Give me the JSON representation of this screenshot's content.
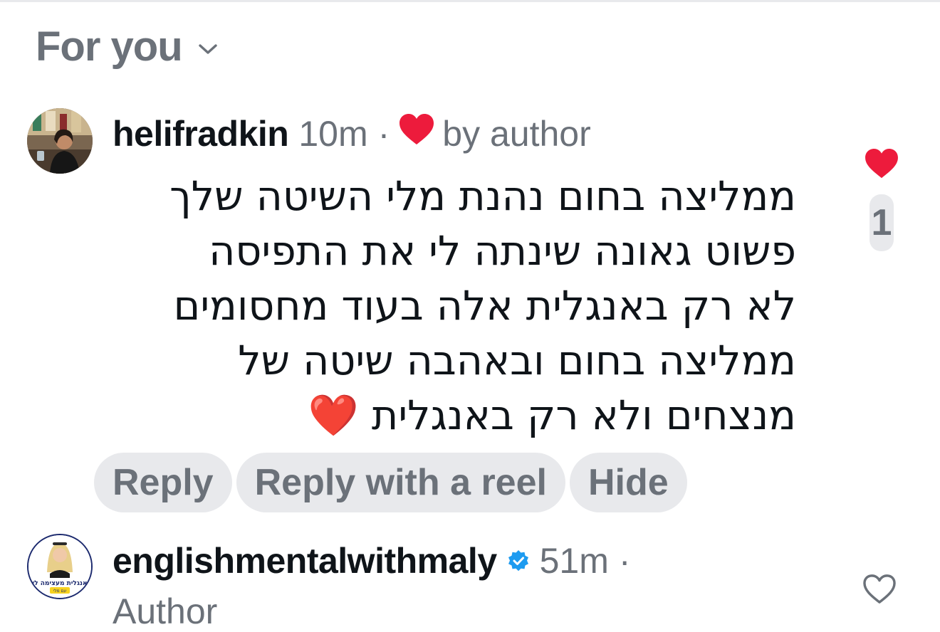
{
  "header": {
    "title": "For you",
    "dropdown_icon": "chevron-down-icon"
  },
  "comments": [
    {
      "username": "helifradkin",
      "time": "10m",
      "separator": "·",
      "liked_by_author_label": "by author",
      "text_lines": [
        "ממליצה בחום נהנת מלי השיטה שלך",
        "פשוט גאונה שינתה לי את התפיסה",
        "לא רק באנגלית אלה בעוד מחסומים",
        "ממליצה בחום ובאהבה שיטה של",
        "מנצחים ולא רק באנגלית ❤️"
      ],
      "like_count": "1",
      "liked": true,
      "actions": {
        "reply": "Reply",
        "reply_reel": "Reply with a reel",
        "hide": "Hide"
      },
      "colors": {
        "heart": "#ed1b3c"
      }
    },
    {
      "username": "englishmentalwithmaly",
      "verified": true,
      "time": "51m",
      "separator": "·",
      "role": "Author",
      "liked": false,
      "avatar_text": "אנגלית מעצימה לי",
      "avatar_subtext": "עם מלי",
      "colors": {
        "verified": "#1d9bf0"
      }
    }
  ]
}
